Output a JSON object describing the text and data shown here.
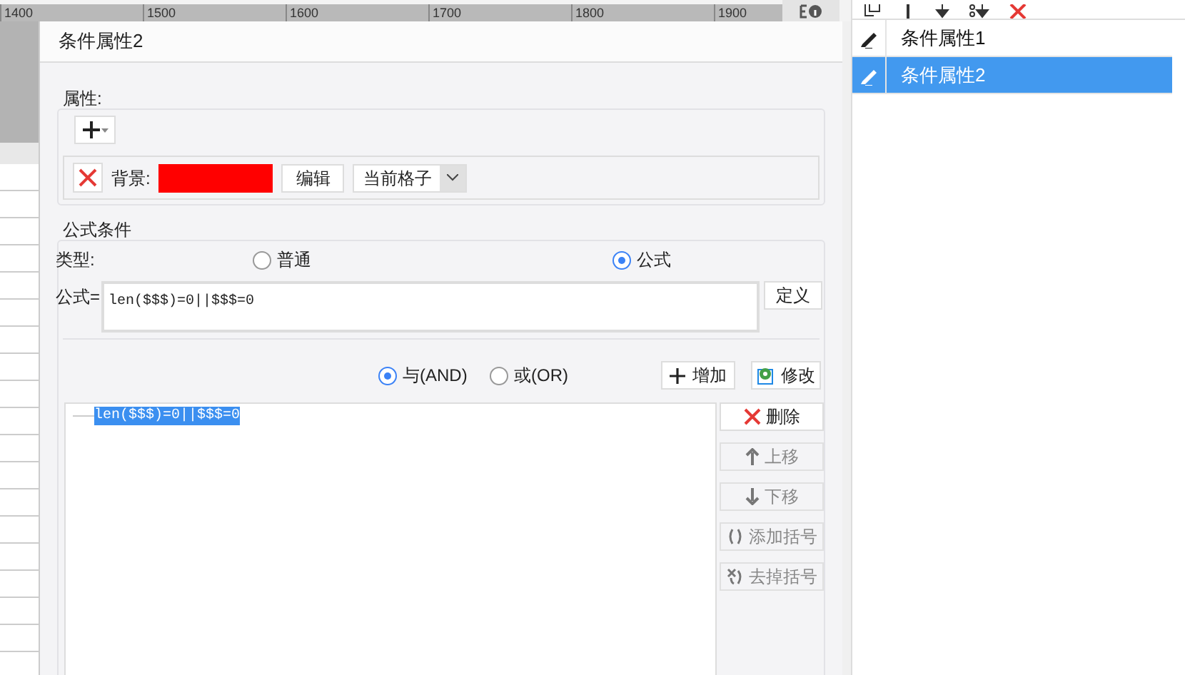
{
  "ruler": {
    "labels": [
      "1400",
      "1500",
      "1600",
      "1700",
      "1800",
      "1900"
    ]
  },
  "dialog": {
    "title": "条件属性2",
    "attributes": {
      "legend": "属性:",
      "background_label": "背景:",
      "edit_button": "编辑",
      "scope": "当前格子"
    },
    "formula_condition": {
      "legend": "公式条件",
      "type_label": "类型:",
      "types": [
        {
          "label": "普通",
          "selected": false
        },
        {
          "label": "公式",
          "selected": true
        }
      ],
      "formula_label": "公式=",
      "formula_value": "len($$$)=0||$$$=0",
      "define_button": "定义",
      "logic": [
        {
          "label": "与(AND)",
          "selected": true
        },
        {
          "label": "或(OR)",
          "selected": false
        }
      ],
      "add_button": "增加",
      "modify_button": "修改",
      "conditions": [
        {
          "text": "len($$$)=0||$$$=0",
          "selected": true
        }
      ],
      "side_buttons": [
        {
          "kind": "delete",
          "label": "删除",
          "disabled": false
        },
        {
          "kind": "up",
          "label": "上移",
          "disabled": true
        },
        {
          "kind": "down",
          "label": "下移",
          "disabled": true
        },
        {
          "kind": "add-brackets",
          "label": "添加括号",
          "disabled": true
        },
        {
          "kind": "remove-brackets",
          "label": "去掉括号",
          "disabled": true
        }
      ]
    }
  },
  "property_list": [
    {
      "label": "条件属性1",
      "selected": false
    },
    {
      "label": "条件属性2",
      "selected": true
    }
  ]
}
